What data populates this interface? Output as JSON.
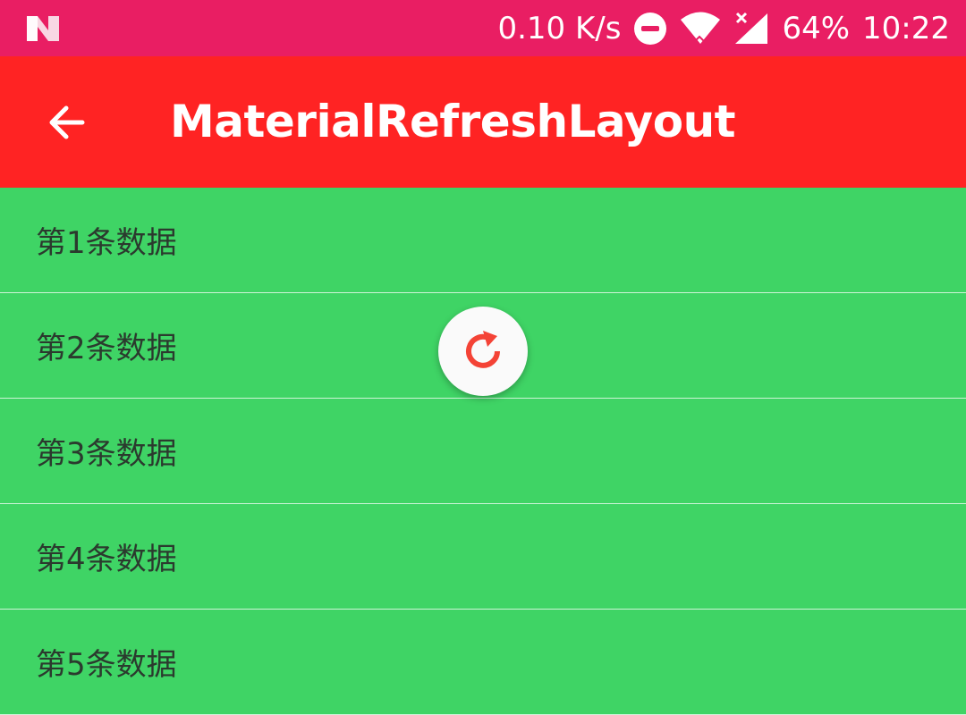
{
  "status_bar": {
    "network_speed": "0.10 K/s",
    "battery": "64%",
    "time": "10:22",
    "icons": [
      "nougat-logo-icon",
      "do-not-disturb-icon",
      "wifi-icon",
      "cell-signal-icon"
    ]
  },
  "app_bar": {
    "back_icon": "arrow-left-icon",
    "title": "MaterialRefreshLayout",
    "background": "#ff2323"
  },
  "list": {
    "background": "#3fd465",
    "items": [
      {
        "label": "第1条数据"
      },
      {
        "label": "第2条数据"
      },
      {
        "label": "第3条数据"
      },
      {
        "label": "第4条数据"
      },
      {
        "label": "第5条数据"
      }
    ]
  },
  "refresh": {
    "icon": "refresh-icon",
    "color": "#f44336"
  }
}
